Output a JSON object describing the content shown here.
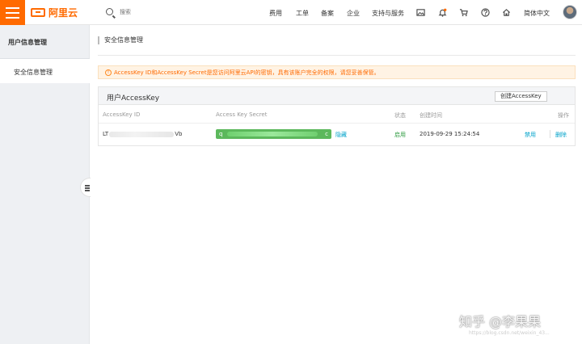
{
  "header": {
    "logo_text": "阿里云",
    "search_placeholder": "搜索",
    "nav": [
      "费用",
      "工单",
      "备案",
      "企业",
      "支持与服务"
    ],
    "language": "简体中文"
  },
  "sidebar": {
    "title": "用户信息管理",
    "items": [
      {
        "label": "安全信息管理",
        "active": true
      }
    ]
  },
  "main": {
    "page_title": "安全信息管理",
    "warning": "AccessKey ID和AccessKey Secret是您访问阿里云API的密钥，具有该账户完全的权限，请您妥善保管。",
    "panel": {
      "title": "用户AccessKey",
      "create_button": "创建AccessKey",
      "columns": [
        "AccessKey ID",
        "Access Key Secret",
        "状态",
        "创建时间",
        "操作"
      ],
      "rows": [
        {
          "key_id_prefix": "LT",
          "key_id_suffix": "Vb",
          "secret_prefix": "q",
          "secret_suffix": "c",
          "hide_link": "隐藏",
          "status": "启用",
          "created": "2019-09-29 15:24:54",
          "actions": [
            "禁用",
            "删除"
          ]
        }
      ]
    }
  },
  "watermark": {
    "text": "知乎 @李果果",
    "url": "https://blog.csdn.net/weixin_43..."
  },
  "colors": {
    "brand": "#ff6a00",
    "link": "#00a2ca",
    "secret_bg": "#5cb85c",
    "status_enabled": "#2b9a3e"
  }
}
